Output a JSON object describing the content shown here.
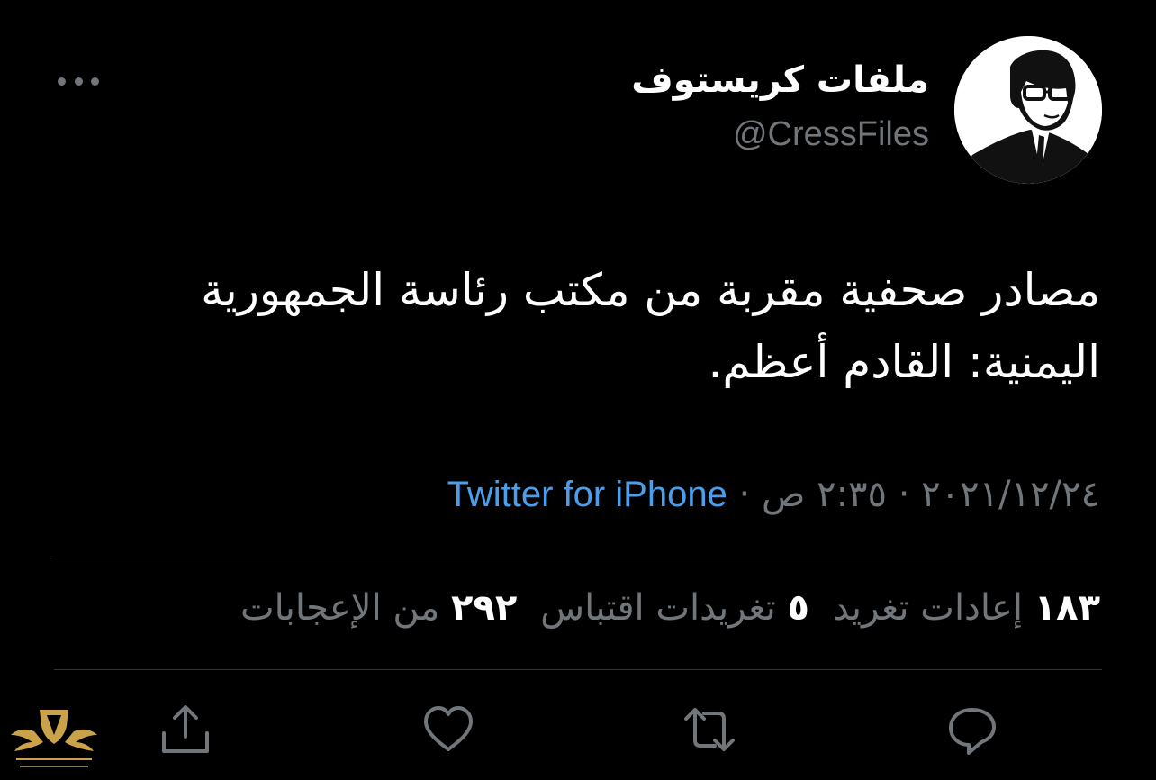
{
  "author": {
    "display_name": "ملفات كريستوف",
    "handle": "@CressFiles"
  },
  "tweet": {
    "text": "مصادر صحفية مقربة من مكتب رئاسة الجمهورية اليمنية: القادم أعظم."
  },
  "meta": {
    "date": "٢٠٢١/١٢/٢٤",
    "separator": " · ",
    "time": "٢:٣٥ ص",
    "source": "Twitter for iPhone"
  },
  "stats": {
    "retweets_count": "١٨٣",
    "retweets_label": "إعادات تغريد",
    "quotes_count": "٥",
    "quotes_label": "تغريدات اقتباس",
    "likes_count": "٢٩٢",
    "likes_label": "من الإعجابات"
  },
  "icons": {
    "more": "more-icon",
    "reply": "reply-icon",
    "retweet": "retweet-icon",
    "like": "like-icon",
    "share": "share-icon"
  },
  "colors": {
    "background": "#000000",
    "text": "#ffffff",
    "muted": "#71767b",
    "link": "#4a9eeb",
    "divider": "#2f3336"
  }
}
